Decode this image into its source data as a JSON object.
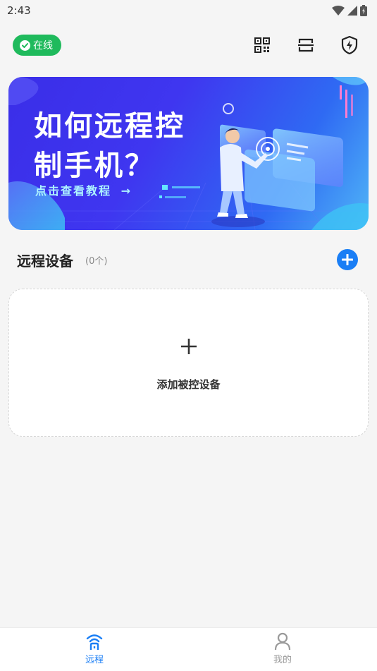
{
  "status_bar": {
    "time": "2:43"
  },
  "top_bar": {
    "online_label": "在线",
    "icons": [
      "qr-code-icon",
      "scan-icon",
      "shield-lightning-icon"
    ]
  },
  "banner": {
    "title_line1": "如何远程控",
    "title_line2": "制手机？",
    "link_label": "点击查看教程",
    "link_arrow": "→"
  },
  "devices": {
    "title": "远程设备",
    "count": "(0个)"
  },
  "add_card": {
    "label": "添加被控设备"
  },
  "bottom_nav": {
    "items": [
      {
        "label": "远程",
        "icon": "remote-signal-icon",
        "active": true
      },
      {
        "label": "我的",
        "icon": "profile-icon",
        "active": false
      }
    ]
  },
  "colors": {
    "online_green": "#1fba5c",
    "accent_blue": "#1a7ef5",
    "nav_inactive": "#999999"
  }
}
